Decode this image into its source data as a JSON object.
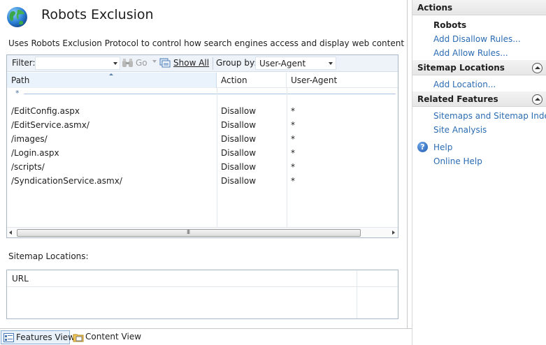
{
  "page": {
    "title": "Robots Exclusion",
    "description": "Uses Robots Exclusion Protocol to control how search engines access and display web content"
  },
  "filter_bar": {
    "filter_label": "Filter:",
    "filter_value": "",
    "go_label": "Go",
    "show_all_label": "Show All",
    "group_by_label": "Group by:",
    "group_by_value": "User-Agent"
  },
  "rules_table": {
    "columns": [
      "Path",
      "Action",
      "User-Agent"
    ],
    "group_label": "*",
    "rows": [
      {
        "path": "/EditConfig.aspx",
        "action": "Disallow",
        "user_agent": "*"
      },
      {
        "path": "/EditService.asmx/",
        "action": "Disallow",
        "user_agent": "*"
      },
      {
        "path": "/images/",
        "action": "Disallow",
        "user_agent": "*"
      },
      {
        "path": "/Login.aspx",
        "action": "Disallow",
        "user_agent": "*"
      },
      {
        "path": "/scripts/",
        "action": "Disallow",
        "user_agent": "*"
      },
      {
        "path": "/SyndicationService.asmx/",
        "action": "Disallow",
        "user_agent": "*"
      }
    ],
    "scroll_grip": "III"
  },
  "sitemap_locations": {
    "label": "Sitemap Locations:",
    "columns": [
      "URL"
    ]
  },
  "view_tabs": {
    "features_view": "Features View",
    "content_view": "Content View",
    "active": "Features View"
  },
  "actions_pane": {
    "title": "Actions",
    "robots_heading": "Robots",
    "add_disallow": "Add Disallow Rules...",
    "add_allow": "Add Allow Rules...",
    "sitemap_section": "Sitemap Locations",
    "add_location": "Add Location...",
    "related_section": "Related Features",
    "sitemaps_indexes": "Sitemaps and Sitemap Indexes",
    "site_analysis": "Site Analysis",
    "help": "Help",
    "online_help": "Online Help"
  },
  "icons": {
    "page_icon": "globe-icon",
    "go_icon": "binoculars-icon",
    "show_all_icon": "show-all-icon",
    "help_icon": "help-icon",
    "features_view_icon": "features-view-icon",
    "content_view_icon": "content-view-icon"
  },
  "colors": {
    "link": "#2b6cb3",
    "selected_header": "#eaf3fb",
    "pane_header": "#e6e6e6"
  }
}
